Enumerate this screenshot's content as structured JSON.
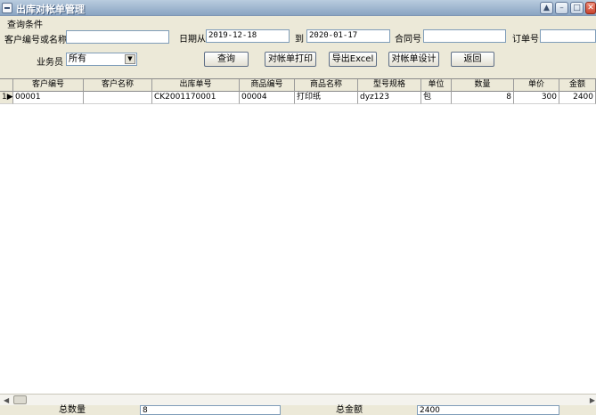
{
  "window": {
    "title": "出库对帐单管理"
  },
  "query": {
    "section_label": "查询条件",
    "customer_label": "客户编号或名称",
    "customer_value": "",
    "date_from_label": "日期从",
    "date_from_value": "2019-12-18",
    "date_to_label": "到",
    "date_to_value": "2020-01-17",
    "contract_label": "合同号",
    "contract_value": "",
    "order_label": "订单号",
    "order_value": "",
    "salesman_label": "业务员",
    "salesman_selected": "所有"
  },
  "buttons": {
    "search": "查询",
    "print": "对帐单打印",
    "export": "导出Excel",
    "design": "对帐单设计",
    "back": "返回"
  },
  "table": {
    "columns": [
      "客户编号",
      "客户名称",
      "出库单号",
      "商品编号",
      "商品名称",
      "型号规格",
      "单位",
      "数量",
      "单价",
      "金额"
    ],
    "rows": [
      {
        "index": "1",
        "customer_id": "00001",
        "customer_name": "",
        "out_no": "CK2001170001",
        "product_id": "00004",
        "product_name": "打印纸",
        "spec": "dyz123",
        "unit": "包",
        "quantity": "8",
        "price": "300",
        "amount": "2400"
      }
    ]
  },
  "footer": {
    "total_qty_label": "总数量",
    "total_qty_value": "8",
    "total_amount_label": "总金额",
    "total_amount_value": "2400"
  },
  "colors": {
    "title_gradient_top": "#b9ccdf",
    "title_gradient_bottom": "#8aa4c2",
    "face": "#ece9d8",
    "input_border": "#7f9db9"
  }
}
